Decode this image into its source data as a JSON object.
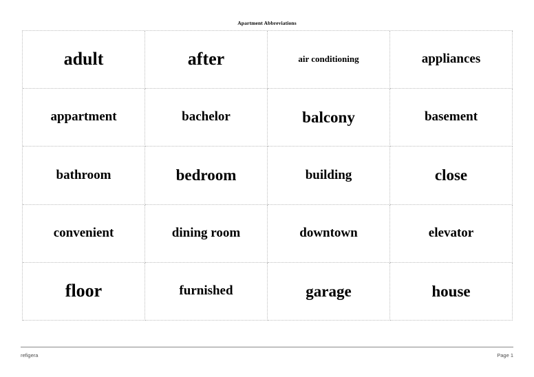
{
  "document": {
    "title": "Apartment Abbreviations",
    "background_color": "#ffffff",
    "text_color": "#000000",
    "grid_border_color": "#bdbdbd"
  },
  "grid": {
    "columns": 4,
    "rows": 5,
    "cells": [
      {
        "word": "adult",
        "size": "fs-xl"
      },
      {
        "word": "after",
        "size": "fs-xl"
      },
      {
        "word": "air conditioning",
        "size": "fs-xs"
      },
      {
        "word": "appliances",
        "size": "fs-md"
      },
      {
        "word": "appartment",
        "size": "fs-md"
      },
      {
        "word": "bachelor",
        "size": "fs-md"
      },
      {
        "word": "balcony",
        "size": "fs-lg"
      },
      {
        "word": "basement",
        "size": "fs-md"
      },
      {
        "word": "bathroom",
        "size": "fs-md"
      },
      {
        "word": "bedroom",
        "size": "fs-lg"
      },
      {
        "word": "building",
        "size": "fs-md"
      },
      {
        "word": "close",
        "size": "fs-lg"
      },
      {
        "word": "convenient",
        "size": "fs-md"
      },
      {
        "word": "dining room",
        "size": "fs-md"
      },
      {
        "word": "downtown",
        "size": "fs-md"
      },
      {
        "word": "elevator",
        "size": "fs-md"
      },
      {
        "word": "floor",
        "size": "fs-xl"
      },
      {
        "word": "furnished",
        "size": "fs-md"
      },
      {
        "word": "garage",
        "size": "fs-lg"
      },
      {
        "word": "house",
        "size": "fs-lg"
      }
    ]
  },
  "footer": {
    "left_label": "refigera",
    "right_label": "Page 1",
    "rule_color": "#8a8a8a"
  }
}
